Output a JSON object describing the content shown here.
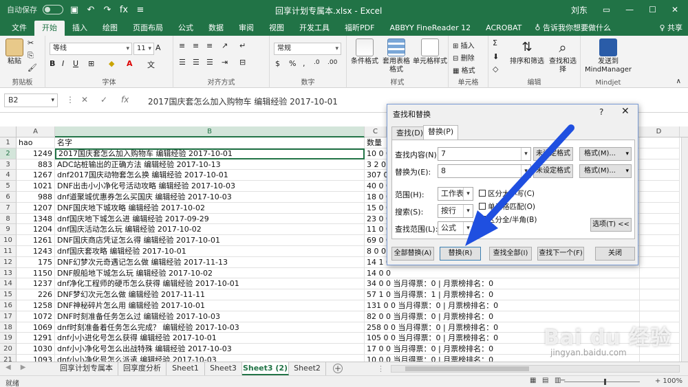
{
  "window": {
    "title": "回享计划专属本.xlsx - Excel",
    "user": "刘东",
    "autosave_label": "自动保存",
    "autosave_state": "关",
    "fx_label": "fx",
    "share_label": "♀ 共享"
  },
  "ribbon_tabs": [
    "文件",
    "开始",
    "插入",
    "绘图",
    "页面布局",
    "公式",
    "数据",
    "审阅",
    "视图",
    "开发工具",
    "福昕PDF",
    "ABBYY FineReader 12",
    "ACROBAT"
  ],
  "active_ribbon_tab": "开始",
  "tell_me": "告诉我你想要做什么",
  "ribbon": {
    "paste": "粘贴",
    "clipboard": "剪贴板",
    "font_name": "等线",
    "font_size": "11",
    "font_group": "字体",
    "align_group": "对齐方式",
    "number_format": "常规",
    "number_group": "数字",
    "cond_format": "条件格式",
    "table_format": "套用表格格式",
    "cell_style": "单元格样式",
    "styles_group": "样式",
    "insert": "插入",
    "delete": "删除",
    "format": "格式",
    "cells_group": "单元格",
    "sort_filter": "排序和筛选",
    "find_select": "查找和选择",
    "editing_group": "编辑",
    "mindmanager": "发送到 MindManager",
    "mindjet_group": "Mindjet"
  },
  "formula_bar": {
    "name_box": "B2",
    "formula": "2017国庆套怎么加入购物车 编辑经验 2017-10-01"
  },
  "columns": [
    "A",
    "B",
    "C",
    "D"
  ],
  "column_d_header": "D",
  "rows": [
    {
      "n": "1",
      "a": "hao",
      "b": "名字",
      "c": "数量"
    },
    {
      "n": "2",
      "a": "1249",
      "b": "2017国庆套怎么加入购物车 编辑经验 2017-10-01",
      "c": "10 0 0"
    },
    {
      "n": "3",
      "a": "883",
      "b": "ADC站桩输出的正确方法 编辑经验 2017-10-13",
      "c": "3 2 0"
    },
    {
      "n": "4",
      "a": "1267",
      "b": "dnf2017国庆动物套怎么换 编辑经验 2017-10-01",
      "c": "307 0"
    },
    {
      "n": "5",
      "a": "1021",
      "b": "DNF出击小小净化号活动攻略 编辑经验 2017-10-03",
      "c": "40 0 0"
    },
    {
      "n": "6",
      "a": "988",
      "b": "dnf道聚城优惠券怎么买国庆 编辑经验 2017-10-03",
      "c": "18 0 0"
    },
    {
      "n": "7",
      "a": "1207",
      "b": "DNF国庆地下城攻略 编辑经验 2017-10-02",
      "c": "15 0 0"
    },
    {
      "n": "8",
      "a": "1348",
      "b": "dnf国庆地下城怎么进 编辑经验 2017-09-29",
      "c": "23 0 0"
    },
    {
      "n": "9",
      "a": "1204",
      "b": "dnf国庆活动怎么玩 编辑经验 2017-10-02",
      "c": "11 0 0"
    },
    {
      "n": "10",
      "a": "1261",
      "b": "DNF国庆商店凭证怎么得 编辑经验 2017-10-01",
      "c": "69 0 0"
    },
    {
      "n": "11",
      "a": "1243",
      "b": "dnf国庆套攻略 编辑经验 2017-10-01",
      "c": "8 0 0"
    },
    {
      "n": "12",
      "a": "175",
      "b": "DNF幻梦次元奇遇记怎么做 编辑经验 2017-11-13",
      "c": "14 1 0"
    },
    {
      "n": "13",
      "a": "1150",
      "b": "DNF舰船地下城怎么玩 编辑经验 2017-10-02",
      "c": "14 0 0"
    },
    {
      "n": "14",
      "a": "1237",
      "b": "dnf净化工程师的硬币怎么获得 编辑经验 2017-10-01",
      "c": "34 0 0 当月得票：0 | 月票榜排名：0"
    },
    {
      "n": "15",
      "a": "226",
      "b": "DNF梦幻次元怎么做 编辑经验 2017-11-11",
      "c": "57 1 0 当月得票：1 | 月票榜排名：0"
    },
    {
      "n": "16",
      "a": "1258",
      "b": "DNF神秘碎片怎么用 编辑经验 2017-10-01",
      "c": "131 0 0 当月得票：0 | 月票榜排名：0"
    },
    {
      "n": "17",
      "a": "1072",
      "b": "DNF时刻准备任务怎么过 编辑经验 2017-10-03",
      "c": "82 0 0 当月得票：0 | 月票榜排名：0"
    },
    {
      "n": "18",
      "a": "1069",
      "b": "dnf时刻准备着任务怎么完成？ 编辑经验 2017-10-03",
      "c": "258 0 0 当月得票：0 | 月票榜排名：0"
    },
    {
      "n": "19",
      "a": "1291",
      "b": "dnf小小进化号怎么获得 编辑经验 2017-10-01",
      "c": "105 0 0 当月得票：0 | 月票榜排名：0"
    },
    {
      "n": "20",
      "a": "1030",
      "b": "dnf小小净化号怎么出战特殊 编辑经验 2017-10-03",
      "c": "17 0 0 当月得票：0 | 月票榜排名：0"
    },
    {
      "n": "21",
      "a": "1093",
      "b": "dnf小小净化号怎么派遣 编辑经验 2017-10-03",
      "c": "10 0 0 当月得票：0 | 月票榜排名：0"
    },
    {
      "n": "22",
      "a": "1090",
      "b": "dnf小小净化号怎么去特殊 编辑经验 2017-10-03",
      "c": "72 0 0 当月得票：0 | 月票榜排名：0"
    }
  ],
  "sheets": [
    "回享计划专属本",
    "回享度分析",
    "Sheet1",
    "Sheet3",
    "Sheet3 (2)",
    "Sheet2"
  ],
  "active_sheet": "Sheet3 (2)",
  "status": {
    "ready": "就绪",
    "zoom": "+ 100%"
  },
  "dialog": {
    "title": "查找和替换",
    "help": "?",
    "tabs": [
      "查找(D)",
      "替换(P)"
    ],
    "active_tab": "替换(P)",
    "find_label": "查找内容(N):",
    "find_value": "7",
    "replace_label": "替换为(E):",
    "replace_value": "8",
    "no_format_1": "未设定格式",
    "no_format_2": "未设定格式",
    "format_btn_1": "格式(M)...",
    "format_btn_2": "格式(M)...",
    "scope_label": "范围(H):",
    "scope_value": "工作表",
    "search_label": "搜索(S):",
    "search_value": "按行",
    "lookin_label": "查找范围(L):",
    "lookin_value": "公式",
    "match_case": "区分大小写(C)",
    "match_cell": "单元格匹配(O)",
    "match_width": "区分全/半角(B)",
    "options_btn": "选项(T) <<",
    "replace_all": "全部替换(A)",
    "replace_one": "替换(R)",
    "find_all": "查找全部(I)",
    "find_next": "查找下一个(F)",
    "close": "关闭"
  },
  "watermark": {
    "logo": "Bai du 经验",
    "url": "jingyan.baidu.com"
  },
  "colors": {
    "excel_green": "#217346",
    "annotation_blue": "#1f4fe0"
  }
}
